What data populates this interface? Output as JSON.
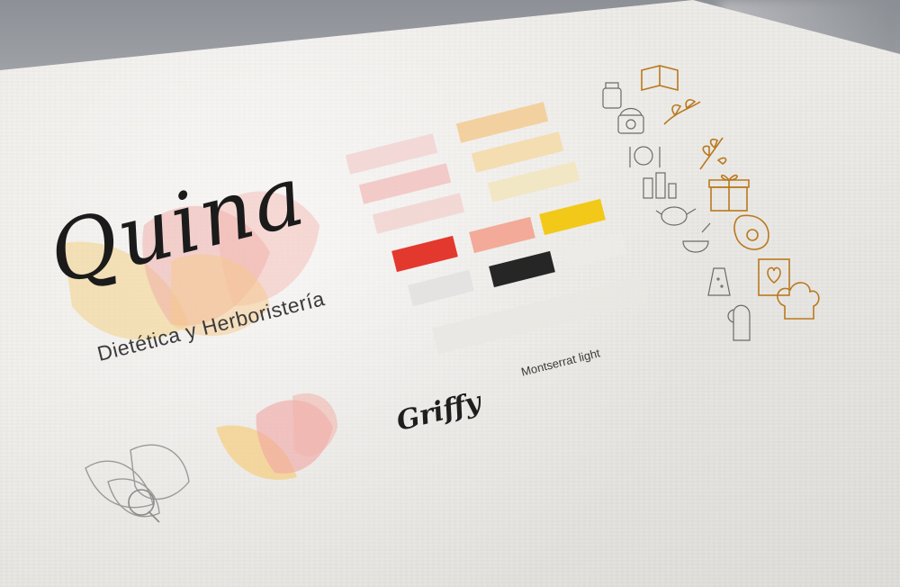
{
  "logo": {
    "wordmark": "Quina",
    "tagline": "Dietética y Herboristería"
  },
  "typography": {
    "display_font": "Griffy",
    "body_font": "Montserrat light"
  },
  "palette": {
    "pinks": [
      "#f2cfcf",
      "#f3c6c3",
      "#f1d4d1"
    ],
    "yellows": [
      "#f3cf98",
      "#f4dcaa",
      "#f1e6bf"
    ],
    "accents": [
      "#e2281c",
      "#f3a490",
      "#f2c607",
      "#151515",
      "#e3e2e0",
      "#e9e7e3"
    ]
  },
  "icons": {
    "sketch_set": [
      "jar-icon",
      "scale-icon",
      "plate-cutlery-icon",
      "bottles-icon",
      "teapot-icon",
      "mortar-icon",
      "grater-icon",
      "oven-mitt-icon"
    ],
    "gold_set": [
      "book-icon",
      "leaf-branch-icon",
      "wheat-icon",
      "gift-box-icon",
      "avocado-icon",
      "recipe-card-icon",
      "chef-hat-icon"
    ]
  },
  "colors": {
    "sketch_stroke": "#6b6b6b",
    "gold_stroke": "#b9791f"
  }
}
